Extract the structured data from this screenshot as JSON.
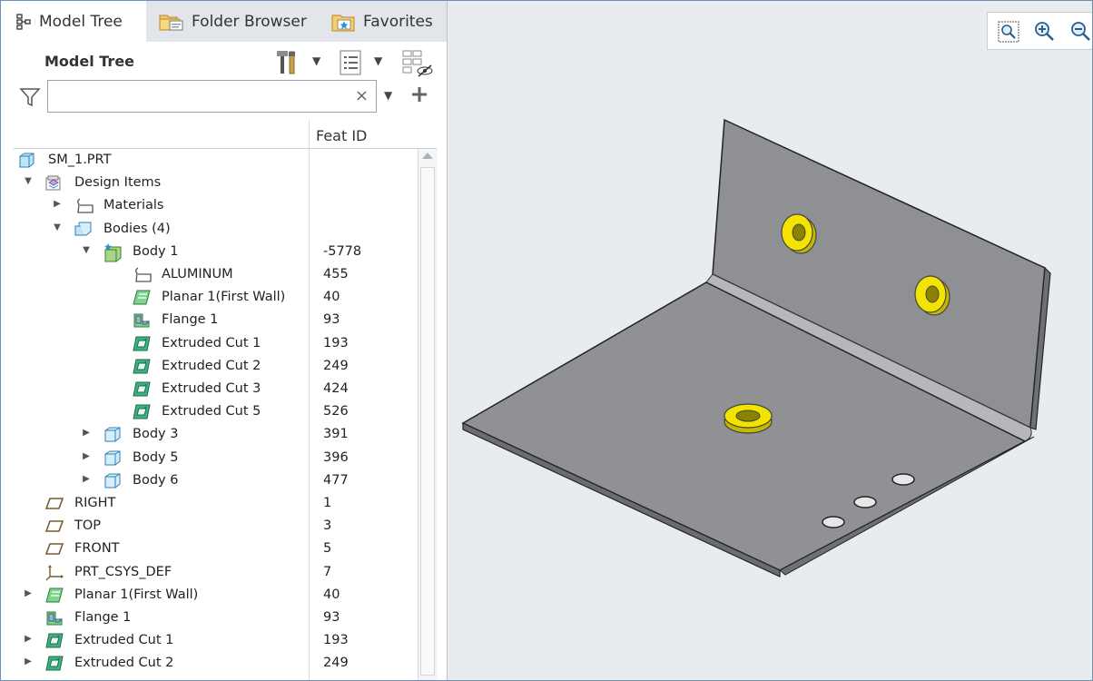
{
  "tabs": [
    {
      "label": "Model Tree",
      "icon": "model-tree-icon",
      "active": true
    },
    {
      "label": "Folder Browser",
      "icon": "folder-browser-icon",
      "active": false
    },
    {
      "label": "Favorites",
      "icon": "favorites-icon",
      "active": false
    }
  ],
  "panel": {
    "title": "Model Tree",
    "search_value": "",
    "clear_label": "×",
    "column_header": "Feat ID"
  },
  "tree": [
    {
      "label": "SM_1.PRT",
      "feat_id": "",
      "icon": "part-icon",
      "indent": 0,
      "toggle": "none"
    },
    {
      "label": "Design Items",
      "feat_id": "",
      "icon": "design-items-icon",
      "indent": 0,
      "toggle": "expanded"
    },
    {
      "label": "Materials",
      "feat_id": "",
      "icon": "material-icon",
      "indent": 1,
      "toggle": "collapsed"
    },
    {
      "label": "Bodies (4)",
      "feat_id": "",
      "icon": "bodies-icon",
      "indent": 1,
      "toggle": "expanded"
    },
    {
      "label": "Body 1",
      "feat_id": "-5778",
      "icon": "body-default-icon",
      "indent": 2,
      "toggle": "expanded"
    },
    {
      "label": "ALUMINUM",
      "feat_id": "455",
      "icon": "material-icon",
      "indent": 3,
      "toggle": "none"
    },
    {
      "label": "Planar 1(First Wall)",
      "feat_id": "40",
      "icon": "planar-wall-icon",
      "indent": 3,
      "toggle": "none"
    },
    {
      "label": "Flange 1",
      "feat_id": "93",
      "icon": "flange-icon",
      "indent": 3,
      "toggle": "none"
    },
    {
      "label": "Extruded Cut 1",
      "feat_id": "193",
      "icon": "extruded-cut-icon",
      "indent": 3,
      "toggle": "none"
    },
    {
      "label": "Extruded Cut 2",
      "feat_id": "249",
      "icon": "extruded-cut-icon",
      "indent": 3,
      "toggle": "none"
    },
    {
      "label": "Extruded Cut 3",
      "feat_id": "424",
      "icon": "extruded-cut-icon",
      "indent": 3,
      "toggle": "none"
    },
    {
      "label": "Extruded Cut 5",
      "feat_id": "526",
      "icon": "extruded-cut-icon",
      "indent": 3,
      "toggle": "none"
    },
    {
      "label": "Body 3",
      "feat_id": "391",
      "icon": "body-icon",
      "indent": 2,
      "toggle": "collapsed"
    },
    {
      "label": "Body 5",
      "feat_id": "396",
      "icon": "body-icon",
      "indent": 2,
      "toggle": "collapsed"
    },
    {
      "label": "Body 6",
      "feat_id": "477",
      "icon": "body-icon",
      "indent": 2,
      "toggle": "collapsed"
    },
    {
      "label": "RIGHT",
      "feat_id": "1",
      "icon": "datum-plane-icon",
      "indent": 0,
      "toggle": "none"
    },
    {
      "label": "TOP",
      "feat_id": "3",
      "icon": "datum-plane-icon",
      "indent": 0,
      "toggle": "none"
    },
    {
      "label": "FRONT",
      "feat_id": "5",
      "icon": "datum-plane-icon",
      "indent": 0,
      "toggle": "none"
    },
    {
      "label": "PRT_CSYS_DEF",
      "feat_id": "7",
      "icon": "csys-icon",
      "indent": 0,
      "toggle": "none"
    },
    {
      "label": "Planar 1(First Wall)",
      "feat_id": "40",
      "icon": "planar-wall-icon",
      "indent": 0,
      "toggle": "collapsed"
    },
    {
      "label": "Flange 1",
      "feat_id": "93",
      "icon": "flange-icon",
      "indent": 0,
      "toggle": "none"
    },
    {
      "label": "Extruded Cut 1",
      "feat_id": "193",
      "icon": "extruded-cut-icon",
      "indent": 0,
      "toggle": "collapsed"
    },
    {
      "label": "Extruded Cut 2",
      "feat_id": "249",
      "icon": "extruded-cut-icon",
      "indent": 0,
      "toggle": "collapsed"
    }
  ],
  "header_tools": [
    "settings-hammer-icon",
    "show-list-icon",
    "hide-columns-icon"
  ],
  "view_toolbar": [
    "refit-icon",
    "zoom-in-icon",
    "zoom-out-icon"
  ],
  "colors": {
    "accent": "#2f8fd6",
    "part_face": "#8f9194",
    "nut": "#f2e400",
    "viewport_bg": "#e9ecee"
  }
}
